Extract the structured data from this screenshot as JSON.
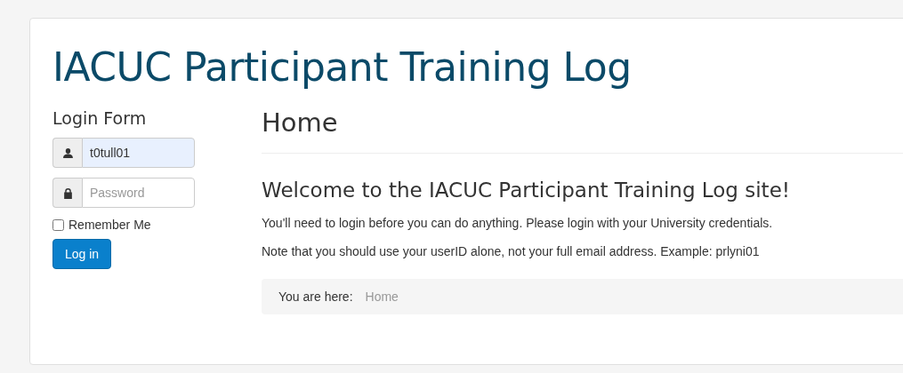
{
  "site_title": "IACUC Participant Training Log",
  "login_form": {
    "heading": "Login Form",
    "username": {
      "value": "t0tull01",
      "autofilled": true
    },
    "password": {
      "placeholder": "Password"
    },
    "remember_me": {
      "label": "Remember Me",
      "checked": false
    },
    "submit": "Log in"
  },
  "main": {
    "heading": "Home",
    "welcome": "Welcome to the IACUC Participant Training Log site!",
    "paragraphs": [
      "You'll need to login before you can do anything. Please login with your University credentials.",
      "Note that you should use your userID alone, not your full email address. Example: prlyni01"
    ],
    "breadcrumb": {
      "label": "You are here:",
      "items": [
        "Home"
      ]
    }
  }
}
